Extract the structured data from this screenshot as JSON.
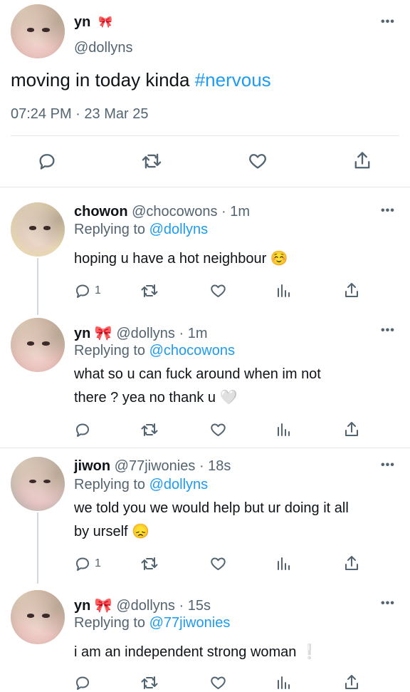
{
  "main_tweet": {
    "display_name": "yn",
    "name_emoji": "🎀",
    "handle": "@dollyns",
    "text_prefix": "moving in today kinda ",
    "hashtag": "#nervous",
    "time": "07:24 PM",
    "separator": "·",
    "date": "23 Mar 25"
  },
  "replies": [
    {
      "display_name": "chowon",
      "handle": "@chocowons",
      "time": "· 1m",
      "replying_label": "Replying to",
      "replying_to": "@dollyns",
      "text": "hoping u have a hot neighbour",
      "text_emoji": "☺️",
      "reply_count": "1"
    },
    {
      "display_name": "yn",
      "name_emoji": "🎀",
      "handle": "@dollyns",
      "time": "· 1m",
      "replying_label": "Replying to",
      "replying_to": "@chocowons",
      "text_line1": "what so u can fuck around when im not",
      "text_line2": "there ? yea no thank u",
      "text_emoji": "🤍",
      "reply_count": ""
    },
    {
      "display_name": "jiwon",
      "handle": "@77jiwonies",
      "time": "· 18s",
      "replying_label": "Replying to",
      "replying_to": "@dollyns",
      "text_line1": "we told you we would help but ur doing it all",
      "text_line2": "by urself",
      "text_emoji": "😞",
      "reply_count": "1"
    },
    {
      "display_name": "yn",
      "name_emoji": "🎀",
      "handle": "@dollyns",
      "time": "· 15s",
      "replying_label": "Replying to",
      "replying_to": "@77jiwonies",
      "text": "i am an independent strong woman",
      "text_emoji": "❕"
    }
  ],
  "more_glyph": "•••",
  "icons": {
    "reply": "reply-icon",
    "retweet": "retweet-icon",
    "like": "heart-icon",
    "views": "views-icon",
    "share": "share-icon"
  },
  "colors": {
    "link": "#1d9bf0",
    "secondary": "#536471",
    "divider": "#e1e5e8"
  }
}
